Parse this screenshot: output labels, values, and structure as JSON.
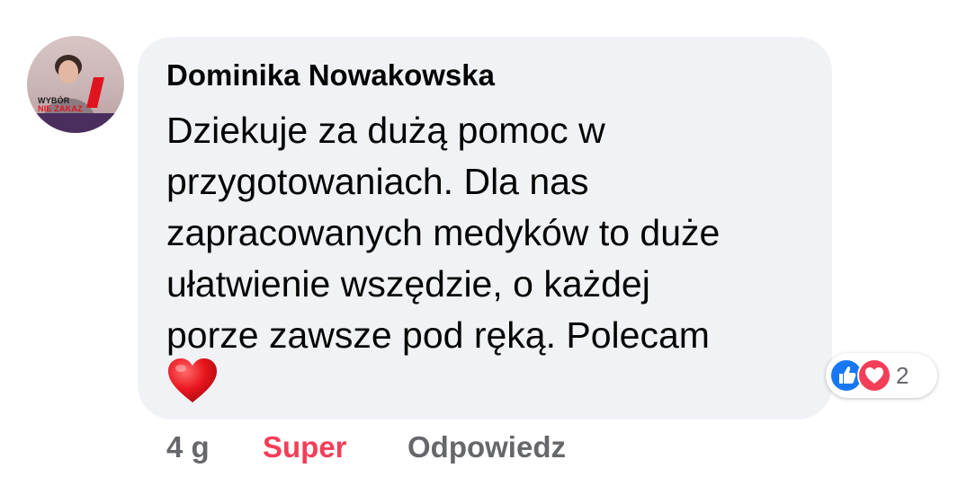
{
  "comment": {
    "author": "Dominika Nowakowska",
    "text_lines": [
      "Dziekuje za dużą pomoc w",
      "przygotowaniach. Dla nas",
      "zapracowanych medyków to duże",
      "ułatwienie wszędzie, o każdej",
      "porze zawsze pod ręką. Polecam"
    ],
    "emoji": "red-heart"
  },
  "avatar": {
    "overlay_line1": "WYBÓR",
    "overlay_line2": "NIE ZAKAZ"
  },
  "reactions": {
    "types": [
      "like",
      "love"
    ],
    "count": "2"
  },
  "footer": {
    "time": "4 g",
    "reaction_label": "Super",
    "reply_label": "Odpowiedz"
  },
  "colors": {
    "bubble_bg": "#f0f2f5",
    "like_blue": "#1877f2",
    "love_red": "#f33e58",
    "muted_text": "#65676b",
    "text": "#050505"
  }
}
